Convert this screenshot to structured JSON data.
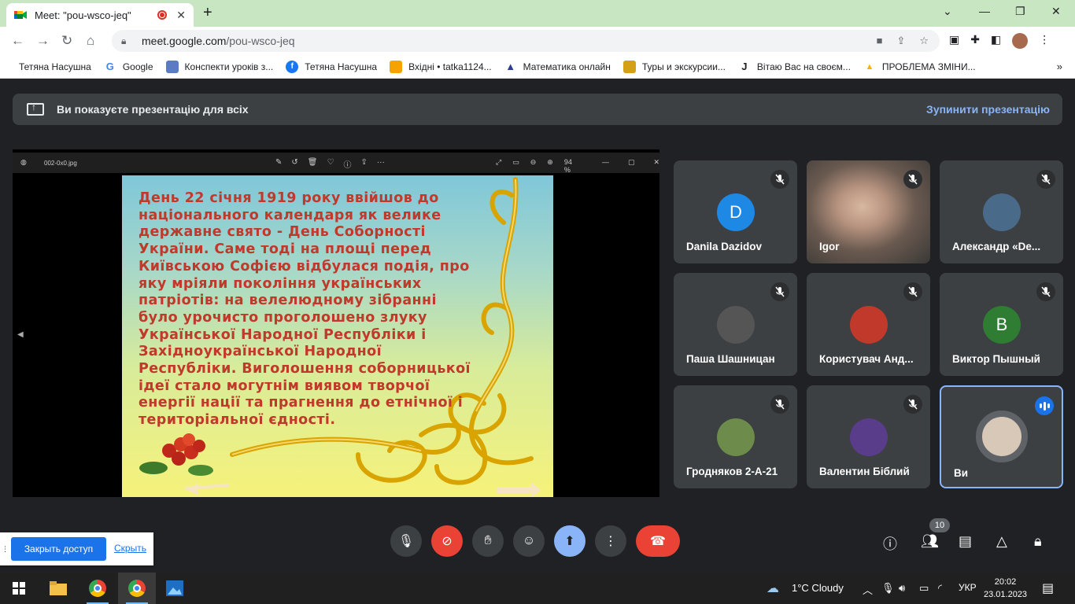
{
  "browser": {
    "tab_title": "Meet: \"pou-wsco-jeq\"",
    "url_host": "meet.google.com",
    "url_path": "/pou-wsco-jeq",
    "bookmarks": [
      {
        "label": "Тетяна Насушна",
        "icon": "globe-icon",
        "color": "#ffffff"
      },
      {
        "label": "Google",
        "icon": "google-icon",
        "color": "#4285f4"
      },
      {
        "label": "Конспекти уроків з...",
        "icon": "shield-icon",
        "color": "#5b7cc4"
      },
      {
        "label": "Тетяна Насушна",
        "icon": "facebook-icon",
        "color": "#1877f2"
      },
      {
        "label": "Вхідні • tatka1124...",
        "icon": "mail-icon",
        "color": "#f4a300"
      },
      {
        "label": "Математика онлайн",
        "icon": "triangle-icon",
        "color": "#2c3e90"
      },
      {
        "label": "Туры и экскурсии...",
        "icon": "travel-icon",
        "color": "#d4a017"
      },
      {
        "label": "Вітаю Вас на своєм...",
        "icon": "j-icon",
        "color": "#202124"
      },
      {
        "label": "ПРОБЛЕМА ЗМІНИ...",
        "icon": "bulb-icon",
        "color": "#f6b400"
      }
    ]
  },
  "meet": {
    "banner_text": "Ви показуєте презентацію для всіх",
    "stop_label": "Зупинити презентацію",
    "viewer": {
      "file_name": "002-0x0.jpg",
      "zoom": "94 %"
    },
    "slide_text": "День 22 січня 1919 року ввійшов до\nнаціонального календаря як велике\nдержавне свято - День Соборності\nУкраїни. Саме тоді на площі перед\nКиївською Софією відбулася подія, про\nяку мріяли покоління українських\nпатріотів: на велелюдному зібранні\nбуло урочисто проголошено злуку\nУкраїнської Народної Республіки і\nЗахідноукраїнської Народної\nРеспубліки. Виголошення соборницької\nідеї стало могутнім виявом творчої\nенергії нації та прагнення до етнічної і\nтериторіальної єдності.",
    "participants": [
      {
        "name": "Danila Dazidov",
        "avatar_letter": "D",
        "avatar_color": "#1e88e5",
        "muted": true
      },
      {
        "name": "Igor",
        "avatar_letter": "",
        "avatar_color": "",
        "muted": true,
        "video": true
      },
      {
        "name": "Александр «De...",
        "avatar_letter": "",
        "avatar_color": "#4a6a8a",
        "muted": true
      },
      {
        "name": "Паша Шашницан",
        "avatar_letter": "",
        "avatar_color": "#555555",
        "muted": true
      },
      {
        "name": "Користувач Анд...",
        "avatar_letter": "",
        "avatar_color": "#c0392b",
        "muted": true
      },
      {
        "name": "Виктор Пышный",
        "avatar_letter": "B",
        "avatar_color": "#2e7d32",
        "muted": true
      },
      {
        "name": "Гродняков 2-А-21",
        "avatar_letter": "",
        "avatar_color": "#6d8b4a",
        "muted": true
      },
      {
        "name": "Валентин Біблий",
        "avatar_letter": "",
        "avatar_color": "#5a3d8a",
        "muted": true
      },
      {
        "name": "Ви",
        "avatar_letter": "",
        "avatar_color": "#d8c8b8",
        "muted": false,
        "speaking": true
      }
    ],
    "people_count": "10",
    "share_button": "Закрыть доступ",
    "share_hide": "Скрыть"
  },
  "taskbar": {
    "weather": "1°C  Cloudy",
    "lang": "УКР",
    "time": "20:02",
    "date": "23.01.2023"
  }
}
